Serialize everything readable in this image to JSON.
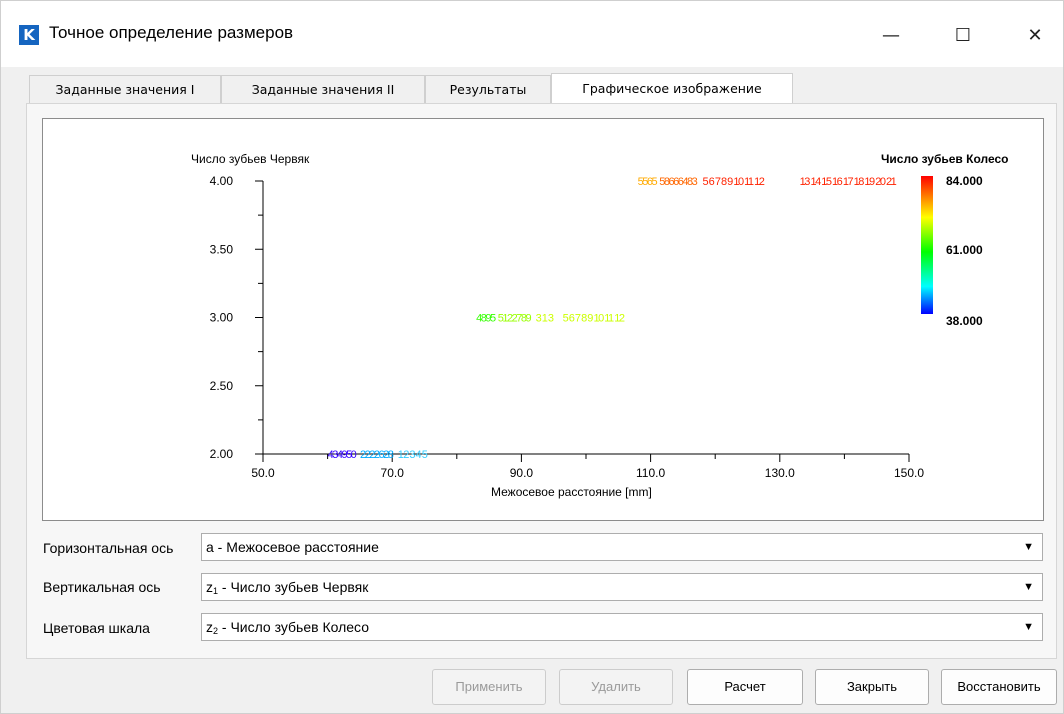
{
  "window": {
    "app_icon_letter": "K",
    "title": "Точное определение размеров",
    "minimize_glyph": "—",
    "maximize_glyph": "☐",
    "close_glyph": "✕"
  },
  "tabs": [
    {
      "label": "Заданные значения I"
    },
    {
      "label": "Заданные значения II"
    },
    {
      "label": "Результаты"
    },
    {
      "label": "Графическое изображение",
      "active": true
    }
  ],
  "chart_data": {
    "type": "scatter",
    "xlabel": "Межосевое расстояние [mm]",
    "ylabel": "Число зубьев Червяк",
    "colorbar_label": "Число зубьев Колесо",
    "xlim": [
      50,
      150
    ],
    "ylim": [
      2,
      4
    ],
    "xticks": [
      "50.0",
      "70.0",
      "90.0",
      "110.0",
      "130.0",
      "150.0"
    ],
    "yticks": [
      "2.00",
      "2.50",
      "3.00",
      "3.50",
      "4.00"
    ],
    "colorbar": {
      "min": "38.000",
      "mid": "61.000",
      "max": "84.000",
      "colors": [
        "#0000ff",
        "#00ffff",
        "#00ff00",
        "#ffff00",
        "#ff8000",
        "#ff0000"
      ]
    },
    "groups": [
      {
        "y": 2,
        "x_start": 60,
        "label": "434950",
        "label2": "2222628",
        "label3": "1",
        "tail": "2 3 4 5",
        "colors": [
          "#3300ff",
          "#00aaff",
          "#33ccff"
        ]
      },
      {
        "y": 3,
        "x_start": 83,
        "label": "4895",
        "label2": "5122789",
        "label3": "3 1 3",
        "tail": "5 6 7 8 9 10 11 12",
        "colors": [
          "#33ff00",
          "#99ff00",
          "#ccff00"
        ]
      },
      {
        "y": 4,
        "x_start": 108,
        "label": "5565",
        "label2": "58666483",
        "label3": "5 6 7 8 9 10 11 12",
        "tail": "13 14 15 16 17 18 19 20 21",
        "colors": [
          "#ffaa00",
          "#ff6600",
          "#ff2200"
        ]
      }
    ]
  },
  "controls": {
    "horizontal_label": "Горизонтальная ось",
    "horizontal_value": "a - Межосевое расстояние",
    "vertical_label": "Вертикальная ось",
    "vertical_value_prefix": "z",
    "vertical_value_sub": "1",
    "vertical_value_text": " - Число зубьев Червяк",
    "color_label": "Цветовая шкала",
    "color_value_prefix": "z",
    "color_value_sub": "2",
    "color_value_text": " - Число зубьев Колесо"
  },
  "buttons": {
    "apply": "Применить",
    "delete": "Удалить",
    "calculate": "Расчет",
    "close": "Закрыть",
    "restore": "Восстановить"
  }
}
